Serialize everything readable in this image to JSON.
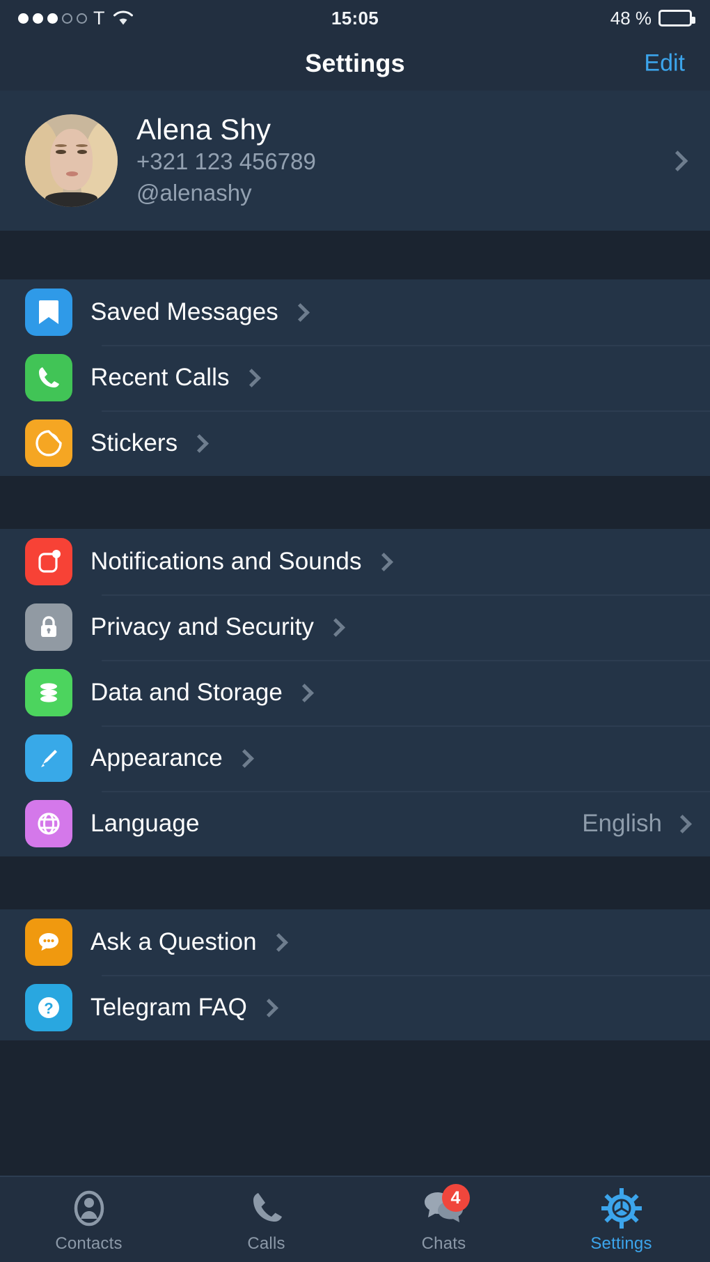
{
  "statusbar": {
    "signal_dots_filled": 3,
    "signal_dots_total": 5,
    "carrier": "T",
    "wifi_icon": "wifi-icon",
    "time": "15:05",
    "battery_text": "48 %",
    "battery_percent": 48
  },
  "navbar": {
    "title": "Settings",
    "edit_label": "Edit"
  },
  "profile": {
    "avatar_icon": "user-avatar",
    "name": "Alena Shy",
    "phone": "+321 123 456789",
    "username": "@alenashy"
  },
  "groups": [
    {
      "rows": [
        {
          "label": "Saved Messages",
          "value": "",
          "icon": "bookmark-icon",
          "icon_color": "#2f9ae8"
        },
        {
          "label": "Recent Calls",
          "value": "",
          "icon": "phone-icon",
          "icon_color": "#41c456"
        },
        {
          "label": "Stickers",
          "value": "",
          "icon": "sticker-icon",
          "icon_color": "#f5a623"
        }
      ]
    },
    {
      "rows": [
        {
          "label": "Notifications and Sounds",
          "value": "",
          "icon": "bell-notification-icon",
          "icon_color": "#f74236"
        },
        {
          "label": "Privacy and Security",
          "value": "",
          "icon": "lock-icon",
          "icon_color": "#919aa3"
        },
        {
          "label": "Data and Storage",
          "value": "",
          "icon": "database-icon",
          "icon_color": "#4cd45e"
        },
        {
          "label": "Appearance",
          "value": "",
          "icon": "paintbrush-icon",
          "icon_color": "#38a9e8"
        },
        {
          "label": "Language",
          "value": "English",
          "icon": "globe-icon",
          "icon_color": "#d濃"
        }
      ]
    },
    {
      "rows": [
        {
          "label": "Ask a Question",
          "value": "",
          "icon": "chat-bubble-icon",
          "icon_color": "#f0990f"
        },
        {
          "label": "Telegram FAQ",
          "value": "",
          "icon": "question-mark-icon",
          "icon_color": "#29a7e0"
        }
      ]
    }
  ],
  "tabbar": {
    "tabs": [
      {
        "label": "Contacts",
        "icon": "contacts-icon",
        "badge": "",
        "active": false
      },
      {
        "label": "Calls",
        "icon": "phone-icon",
        "badge": "",
        "active": false
      },
      {
        "label": "Chats",
        "icon": "chats-icon",
        "badge": "4",
        "active": true
      },
      {
        "label": "Settings",
        "icon": "gear-icon",
        "badge": "",
        "active": true
      }
    ]
  },
  "colors": {
    "accent": "#3ca5ec",
    "row_bg": "#243447",
    "page_bg": "#1b2430",
    "bar_bg": "#222f40",
    "badge_red": "#f0463c",
    "secondary_text": "#93a1b1"
  }
}
